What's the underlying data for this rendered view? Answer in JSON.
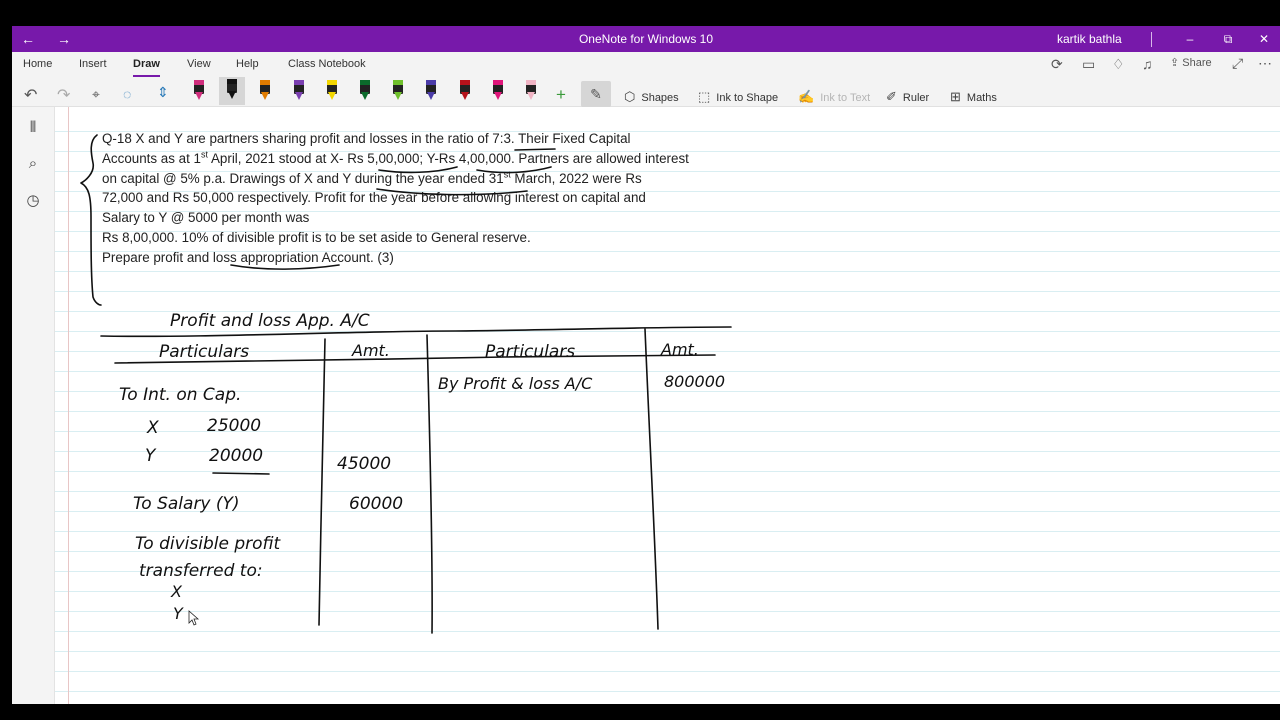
{
  "app": {
    "title": "OneNote for Windows 10",
    "user": "kartik bathla"
  },
  "nav": {
    "back": "←",
    "forward": "→"
  },
  "window_controls": {
    "minimize": "–",
    "restore": "⧉",
    "close": "✕"
  },
  "ribbon": {
    "tabs": [
      "Home",
      "Insert",
      "Draw",
      "View",
      "Help",
      "Class Notebook"
    ],
    "active_tab": "Draw",
    "share_label": "Share",
    "tools": {
      "shapes": "Shapes",
      "ink_to_shape": "Ink to Shape",
      "ink_to_text": "Ink to Text",
      "ruler": "Ruler",
      "maths": "Maths"
    },
    "pen_colors": [
      "#d12e7d",
      "#111111",
      "#e07b00",
      "#7a3fb0",
      "#f2d600",
      "#0b6b2b",
      "#6fc02b",
      "#4b3ca8",
      "#b5121b",
      "#e0157a",
      "#f0b4c4"
    ]
  },
  "question": {
    "line1_a": "Q-18 X and Y are partners sharing profit and losses in the ratio of ",
    "line1_b": "7:3.",
    "line1_c": " Their Fixed Capital",
    "line2_a": "Accounts as at 1",
    "line2_sup": "st",
    "line2_b": " April, 2021 stood at X- Rs 5,00,000; Y-Rs 4,00,000. Partners are allowed interest",
    "line3": "on capital @ 5% p.a.  Drawings of X and Y during the year ended 31",
    "line3_sup": "st",
    "line3_b": " March, 2022 were Rs",
    "line4": "72,000 and Rs 50,000 respectively. Profit for the year before allowing interest on capital and",
    "line5": "Salary to Y @ 5000 per month was",
    "line6": "Rs 8,00,000. 10% of divisible profit is to be set aside to General reserve.",
    "line7": "Prepare profit and loss appropriation Account. (3)"
  },
  "handwriting": {
    "heading": "Profit and loss   App. A/C",
    "col1": "Particulars",
    "col2": "Amt.",
    "col3": "Particulars",
    "col4": "Amt.",
    "int_on_cap": "To Int. on Cap.",
    "x_label": "X",
    "x_val": "25000",
    "y_label": "Y",
    "y_val": "20000",
    "int_total": "45000",
    "salary": "To Salary (Y)",
    "salary_amt": "60000",
    "divisible1": "To divisible profit",
    "divisible2": "transferred to:",
    "x2": "X",
    "y2": "Y",
    "by_pl": "By Profit & loss A/C",
    "by_pl_amt": "800000"
  }
}
